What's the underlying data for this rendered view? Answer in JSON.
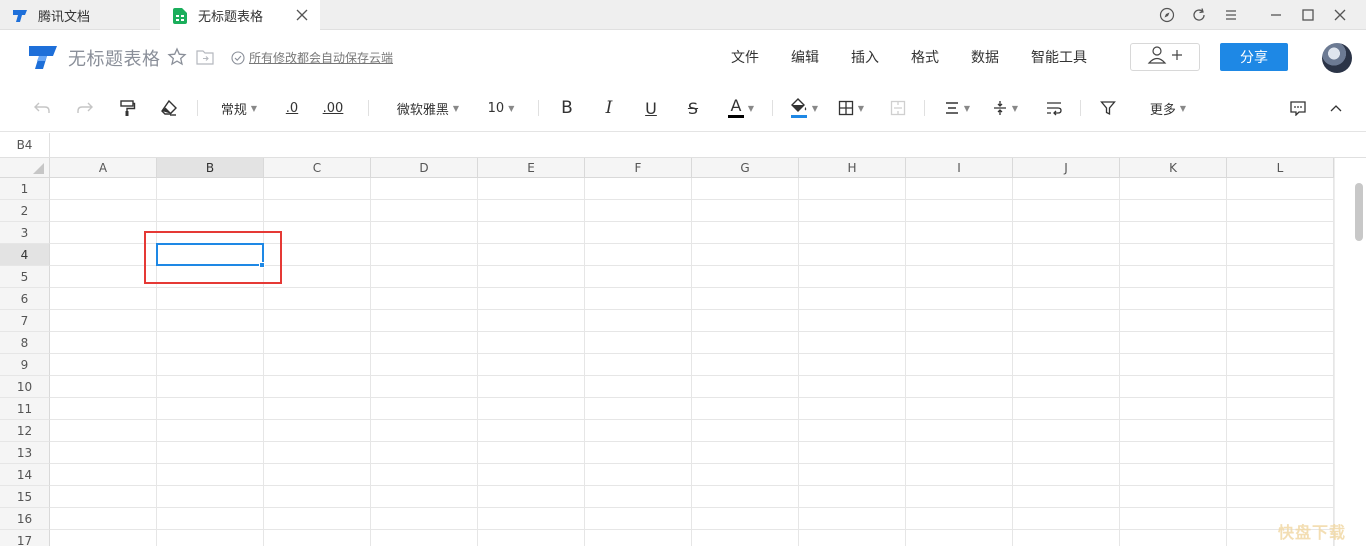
{
  "tabs": [
    {
      "label": "腾讯文档",
      "icon": "tencent-docs-logo-icon"
    },
    {
      "label": "无标题表格",
      "icon": "sheet-icon",
      "active": true
    }
  ],
  "header": {
    "title": "无标题表格",
    "save_status": "所有修改都会自动保存云端",
    "menu": [
      "文件",
      "编辑",
      "插入",
      "格式",
      "数据",
      "智能工具"
    ],
    "share_label": "分享"
  },
  "toolbar": {
    "number_format": "常规",
    "decrease_decimal": ".0",
    "increase_decimal": ".00",
    "font_family": "微软雅黑",
    "font_size": "10",
    "bold": "B",
    "italic": "I",
    "underline": "U",
    "strikethrough": "S",
    "font_color_glyph": "A",
    "more_label": "更多",
    "font_color": "#000000",
    "fill_color": "#1e88e5"
  },
  "name_box": "B4",
  "columns": [
    "A",
    "B",
    "C",
    "D",
    "E",
    "F",
    "G",
    "H",
    "I",
    "J",
    "K",
    "L"
  ],
  "rows": [
    "1",
    "2",
    "3",
    "4",
    "5",
    "6",
    "7",
    "8",
    "9",
    "10",
    "11",
    "12",
    "13",
    "14",
    "15",
    "16",
    "17"
  ],
  "selected_cell": {
    "column": "B",
    "row": "4"
  },
  "watermark": "快盘下载",
  "colors": {
    "accent": "#1e88e5",
    "highlight": "#e53935"
  }
}
